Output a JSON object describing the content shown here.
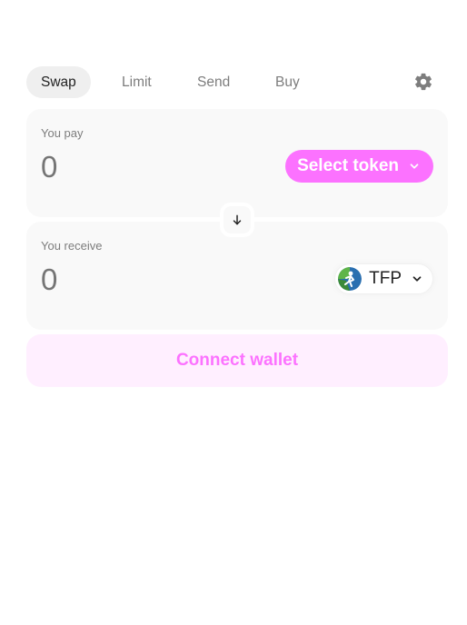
{
  "tabs": [
    {
      "label": "Swap",
      "active": true
    },
    {
      "label": "Limit",
      "active": false
    },
    {
      "label": "Send",
      "active": false
    },
    {
      "label": "Buy",
      "active": false
    }
  ],
  "settings_icon": "gear-icon",
  "pay": {
    "label": "You pay",
    "amount_placeholder": "0",
    "select_token_label": "Select token"
  },
  "receive": {
    "label": "You receive",
    "amount_placeholder": "0",
    "token_symbol": "TFP",
    "token_icon": "tfp-token-logo"
  },
  "switch_icon": "arrow-down-icon",
  "connect_wallet_label": "Connect wallet",
  "colors": {
    "accent": "#fc72ff",
    "accent_soft": "#ffefff",
    "panel_bg": "#f9f9f9",
    "muted_text": "#7d7d7d"
  }
}
